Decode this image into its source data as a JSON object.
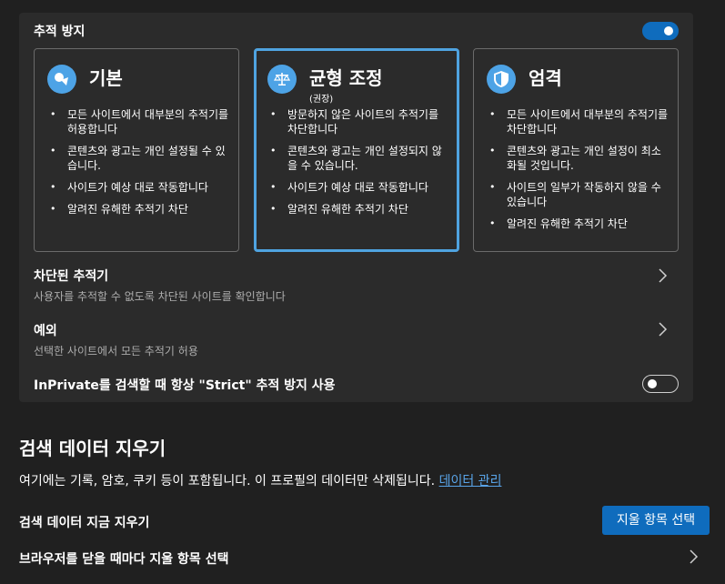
{
  "tracking": {
    "title": "추적 방지",
    "enabled": true,
    "options": [
      {
        "name": "기본",
        "sub": "",
        "icon": "basic-icon",
        "selected": false,
        "bullets": [
          "모든 사이트에서 대부분의 추적기를 허용합니다",
          "콘텐츠와 광고는 개인 설정될 수 있습니다.",
          "사이트가 예상 대로 작동합니다",
          "알려진 유해한 추적기 차단"
        ]
      },
      {
        "name": "균형 조정",
        "sub": "(권장)",
        "icon": "balance-scale-icon",
        "selected": true,
        "bullets": [
          "방문하지 않은 사이트의 추적기를 차단합니다",
          "콘텐츠와 광고는 개인 설정되지 않을 수 있습니다.",
          "사이트가 예상 대로 작동합니다",
          "알려진 유해한 추적기 차단"
        ]
      },
      {
        "name": "엄격",
        "sub": "",
        "icon": "shield-icon",
        "selected": false,
        "bullets": [
          "모든 사이트에서 대부분의 추적기를 차단합니다",
          "콘텐츠와 광고는 개인 설정이 최소화될 것입니다.",
          "사이트의 일부가 작동하지 않을 수 있습니다",
          "알려진 유해한 추적기 차단"
        ]
      }
    ],
    "blocked_title": "차단된 추적기",
    "blocked_sub": "사용자를 추적할 수 없도록 차단된 사이트를 확인합니다",
    "exceptions_title": "예외",
    "exceptions_sub": "선택한 사이트에서 모든 추적기 허용",
    "inprivate_label": "InPrivate를 검색할 때 항상 \"Strict\" 추적 방지 사용",
    "inprivate_enabled": false
  },
  "clear": {
    "heading": "검색 데이터 지우기",
    "description": "여기에는 기록, 암호, 쿠키 등이 포함됩니다. 이 프로필의 데이터만 삭제됩니다.",
    "manage_link": "데이터 관리",
    "now_label": "검색 데이터 지금 지우기",
    "choose_button": "지울 항목 선택",
    "on_close_label": "브라우저를 닫을 때마다 지울 항목 선택"
  }
}
